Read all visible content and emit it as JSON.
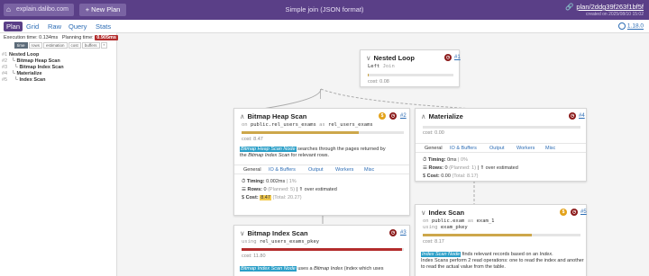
{
  "header": {
    "logo_text": "explain.dalibo.com",
    "new_plan_label": "+ New Plan",
    "title": "Simple join (JSON format)",
    "plan_link": "plan/2ddg39f263f1bf5f",
    "created": "created on 2025/08/10 15:02"
  },
  "tabs": [
    {
      "label": "Plan",
      "active": true
    },
    {
      "label": "Grid"
    },
    {
      "label": "Raw"
    },
    {
      "label": "Query"
    },
    {
      "label": "Stats"
    }
  ],
  "version": "1.18.0",
  "sidebar": {
    "execution_label": "Execution time:",
    "execution_value": "0.134ms",
    "planning_label": "Planning time:",
    "planning_value": "0.905ms",
    "chips": [
      "time",
      "rows",
      "estimation",
      "cost",
      "buffers",
      "*"
    ],
    "tree": [
      {
        "num": "#1",
        "label": "Nested Loop",
        "indent": 0
      },
      {
        "num": "#2",
        "label": "Bitmap Heap Scan",
        "indent": 1
      },
      {
        "num": "#3",
        "label": "Bitmap Index Scan",
        "indent": 2
      },
      {
        "num": "#4",
        "label": "Materialize",
        "indent": 1
      },
      {
        "num": "#5",
        "label": "Index Scan",
        "indent": 2
      }
    ]
  },
  "nodes": {
    "nested_loop": {
      "title": "Nested Loop",
      "id": "#1",
      "sub_kw": "Left",
      "sub_val": "Join",
      "cost": "cost: 0.08",
      "cost_fraction": 0.01
    },
    "bitmap_heap": {
      "title": "Bitmap Heap Scan",
      "id": "#2",
      "sub": [
        "on",
        "public.rel_users_exams",
        "as",
        "rel_users_exams"
      ],
      "cost": "cost: 8.47",
      "cost_fraction": 0.72,
      "desc_hl": "Bitmap Heap Scan Node",
      "desc_1": " searches through the pages returned by",
      "desc_2a": "the ",
      "desc_2_italic": "Bitmap Index Scan",
      "desc_2b": " for relevant rows.",
      "ntabs": [
        "General",
        "IO & Buffers",
        "Output",
        "Workers",
        "Misc"
      ],
      "timing_label": "Timing:",
      "timing_value": "0.002ms",
      "timing_pct": "| 1%",
      "rows_label": "Rows:",
      "rows_value": "0",
      "rows_planned": "(Planned: 5)",
      "rows_est": "| ⇑ over estimated",
      "cost_label": "Cost:",
      "cost_value": "8.47",
      "cost_total": "(Total: 20.27)"
    },
    "materialize": {
      "title": "Materialize",
      "id": "#4",
      "cost": "cost: 0.00",
      "cost_fraction": 0.0,
      "ntabs": [
        "General",
        "IO & Buffers",
        "Output",
        "Workers",
        "Misc"
      ],
      "timing_label": "Timing:",
      "timing_value": "0ms",
      "timing_pct": "| 0%",
      "rows_label": "Rows:",
      "rows_value": "0",
      "rows_planned": "(Planned: 1)",
      "rows_est": "| ⇑ over estimated",
      "cost_label": "Cost:",
      "cost_value": "0.00",
      "cost_total": "(Total: 8.17)"
    },
    "bitmap_index": {
      "title": "Bitmap Index Scan",
      "id": "#3",
      "sub": [
        "using",
        "rel_users_exams_pkey"
      ],
      "cost": "cost: 11.80",
      "cost_fraction": 0.99,
      "desc_hl": "Bitmap Index Scan Node",
      "desc_1": " uses a ",
      "desc_italic": "Bitmap Index",
      "desc_2": " (index which uses"
    },
    "index_scan": {
      "title": "Index Scan",
      "id": "#5",
      "sub1": [
        "on",
        "public.exam",
        "as",
        "exam_1"
      ],
      "sub2": [
        "using",
        "exam_pkey"
      ],
      "cost": "cost: 8.17",
      "cost_fraction": 0.69,
      "desc_hl": "Index Scan Node",
      "desc_1": " finds relevant records based on an ",
      "desc_idx": "Index",
      "desc_1b": ".",
      "desc_2": "Index Scans perform 2 read operations: one to read the index and another",
      "desc_3": "to read the actual value from the table."
    }
  },
  "colors": {
    "brand": "#5a3f87",
    "cost_bar": "#cda74b",
    "cost_bar_red": "#b32c2c",
    "link": "#2d6db5",
    "node_hl": "#2b9fc8"
  }
}
